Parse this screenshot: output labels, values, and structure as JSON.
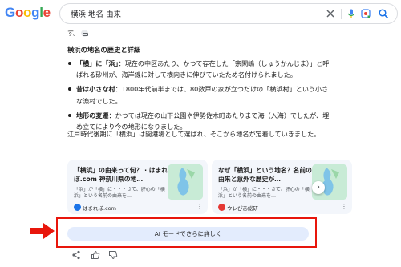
{
  "search": {
    "query": "横浜 地名 由来"
  },
  "answer": {
    "fragment": "す。",
    "section_title": "横浜の地名の歴史と詳細",
    "points": [
      {
        "label": "「横」に「浜」",
        "text": "：現在の中区あたり、かつて存在した「宗閑嶋（しゅうかんじま）」と呼ばれる砂州が、海岸線に対して横向きに伸びていたため名付けられました。"
      },
      {
        "label": "昔は小さな村",
        "text": "：1800年代前半までは、80数戸の家が立つだけの「横浜村」という小さな漁村でした。"
      },
      {
        "label": "地形の変遷",
        "text": "：かつては現在の山下公園や伊勢佐木町あたりまで海（入海）でしたが、埋め立てにより今の地形になりました。"
      }
    ],
    "closing": "江戸時代後期に「横浜」は開港場として選ばれ、そこから地名が定着していきました。"
  },
  "cards": [
    {
      "title": "「横浜」の由来って何？ · はまれぽ.com 神奈川県の地…",
      "snippet": "「浜」が「横」に・・・さて、肝心の「横浜」という名前の由来を…",
      "source": "はまれぽ.com",
      "source_color": "#1a73e8"
    },
    {
      "title": "なぜ「横浜」という地名？名前の由来と意外な歴史が…",
      "snippet": "「浜」が「横」に・・・さて、肝心の「横浜」という名前の由来を…",
      "source": "ウレぴあ総研",
      "source_color": "#e53935"
    }
  ],
  "ai_mode_button": "AI モードでさらに詳しく",
  "colors": {
    "highlight_frame": "#e8160c",
    "arrow": "#e8160c",
    "ai_button_bg": "#e3ecfd"
  }
}
